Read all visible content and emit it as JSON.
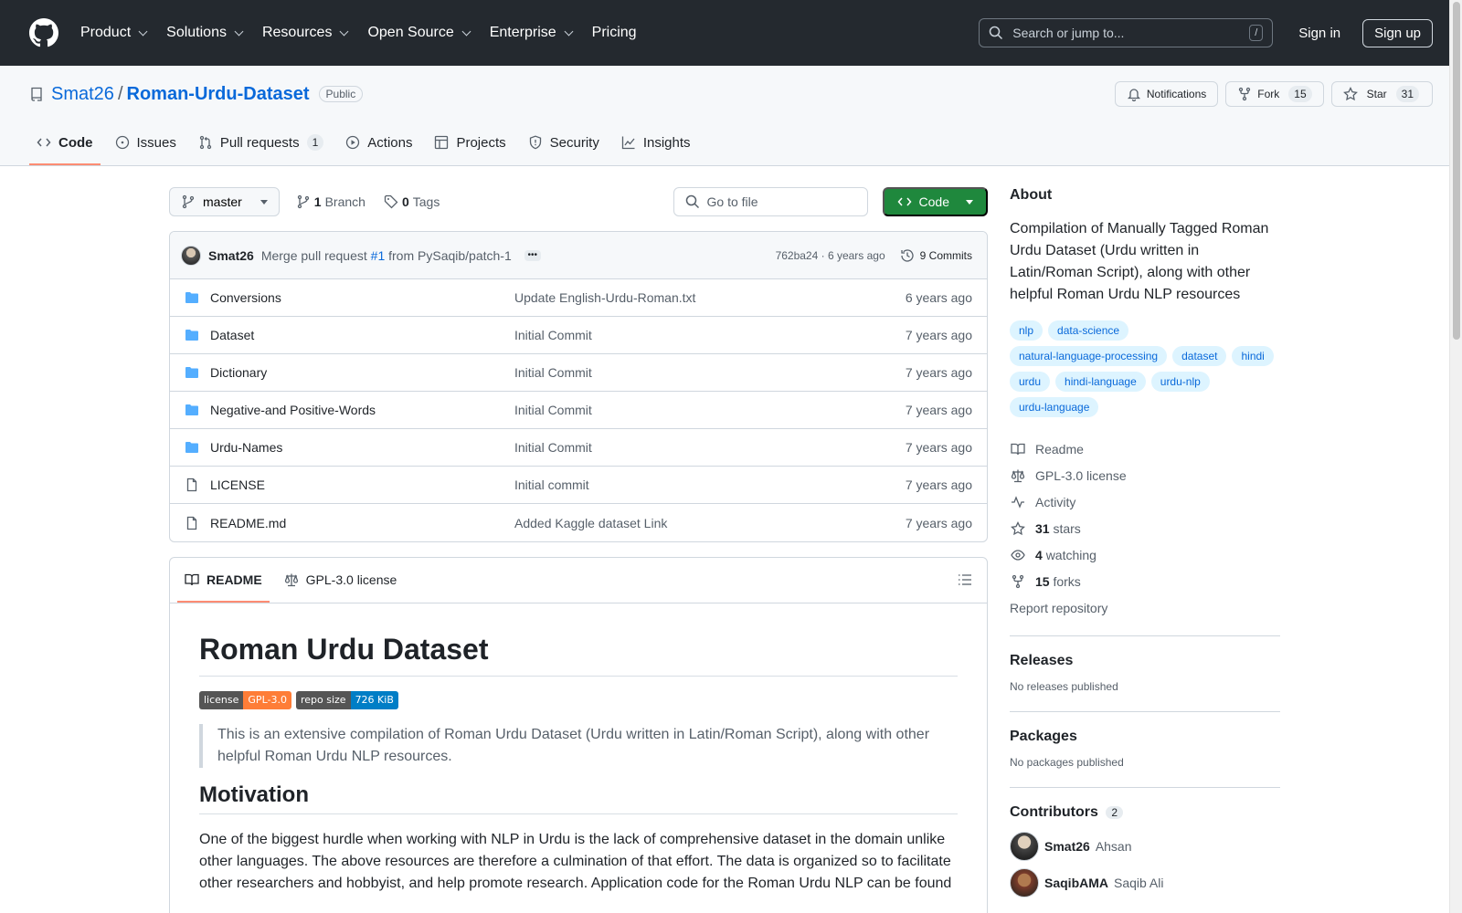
{
  "header": {
    "nav": [
      "Product",
      "Solutions",
      "Resources",
      "Open Source",
      "Enterprise",
      "Pricing"
    ],
    "search_placeholder": "Search or jump to...",
    "slash": "/",
    "sign_in": "Sign in",
    "sign_up": "Sign up"
  },
  "repo": {
    "owner": "Smat26",
    "separator": "/",
    "name": "Roman-Urdu-Dataset",
    "visibility": "Public",
    "notifications": "Notifications",
    "fork_label": "Fork",
    "fork_count": "15",
    "star_label": "Star",
    "star_count": "31",
    "tabs": [
      {
        "label": "Code",
        "icon": "code-icon"
      },
      {
        "label": "Issues",
        "icon": "issue-icon"
      },
      {
        "label": "Pull requests",
        "icon": "pull-request-icon",
        "count": "1"
      },
      {
        "label": "Actions",
        "icon": "play-icon"
      },
      {
        "label": "Projects",
        "icon": "table-icon"
      },
      {
        "label": "Security",
        "icon": "shield-icon"
      },
      {
        "label": "Insights",
        "icon": "graph-icon"
      }
    ]
  },
  "toolbar": {
    "branch": "master",
    "branch_count": "1",
    "branch_label": "Branch",
    "tag_count": "0",
    "tag_label": "Tags",
    "goto_placeholder": "Go to file",
    "code_button": "Code"
  },
  "commit": {
    "author": "Smat26",
    "message_pre": "Merge pull request",
    "pr": "#1",
    "message_post": "from PySaqib/patch-1",
    "ellipsis": "•••",
    "meta": "762ba24 · 6 years ago",
    "count_label": "9 Commits"
  },
  "files": [
    {
      "type": "folder",
      "name": "Conversions",
      "commit": "Update English-Urdu-Roman.txt",
      "time": "6 years ago"
    },
    {
      "type": "folder",
      "name": "Dataset",
      "commit": "Initial Commit",
      "time": "7 years ago"
    },
    {
      "type": "folder",
      "name": "Dictionary",
      "commit": "Initial Commit",
      "time": "7 years ago"
    },
    {
      "type": "folder",
      "name": "Negative-and Positive-Words",
      "commit": "Initial Commit",
      "time": "7 years ago"
    },
    {
      "type": "folder",
      "name": "Urdu-Names",
      "commit": "Initial Commit",
      "time": "7 years ago"
    },
    {
      "type": "file",
      "name": "LICENSE",
      "commit": "Initial commit",
      "time": "7 years ago"
    },
    {
      "type": "file",
      "name": "README.md",
      "commit": "Added Kaggle dataset Link",
      "time": "7 years ago"
    }
  ],
  "readme": {
    "tab_readme": "README",
    "tab_license": "GPL-3.0 license",
    "title": "Roman Urdu Dataset",
    "badge1_left": "license",
    "badge1_right": "GPL-3.0",
    "badge2_left": "repo size",
    "badge2_right": "726 KiB",
    "quote": "This is an extensive compilation of Roman Urdu Dataset (Urdu written in Latin/Roman Script), along with other helpful Roman Urdu NLP resources.",
    "h_motivation": "Motivation",
    "motivation": "One of the biggest hurdle when working with NLP in Urdu is the lack of comprehensive dataset in the domain unlike other languages. The above resources are therefore a culmination of that effort. The data is organized so to facilitate other researchers and hobbyist, and help promote research. Application code for the Roman Urdu NLP can be found"
  },
  "sidebar": {
    "about_title": "About",
    "about_text": "Compilation of Manually Tagged Roman Urdu Dataset (Urdu written in Latin/Roman Script), along with other helpful Roman Urdu NLP resources",
    "topics": [
      "nlp",
      "data-science",
      "natural-language-processing",
      "dataset",
      "hindi",
      "urdu",
      "hindi-language",
      "urdu-nlp",
      "urdu-language"
    ],
    "readme": "Readme",
    "license": "GPL-3.0 license",
    "activity": "Activity",
    "stars_count": "31",
    "stars_label": "stars",
    "watching_count": "4",
    "watching_label": "watching",
    "forks_count": "15",
    "forks_label": "forks",
    "report": "Report repository",
    "releases_title": "Releases",
    "releases_text": "No releases published",
    "packages_title": "Packages",
    "packages_text": "No packages published",
    "contributors_title": "Contributors",
    "contributors_count": "2",
    "contributors": [
      {
        "login": "Smat26",
        "name": "Ahsan"
      },
      {
        "login": "SaqibAMA",
        "name": "Saqib Ali"
      }
    ]
  }
}
